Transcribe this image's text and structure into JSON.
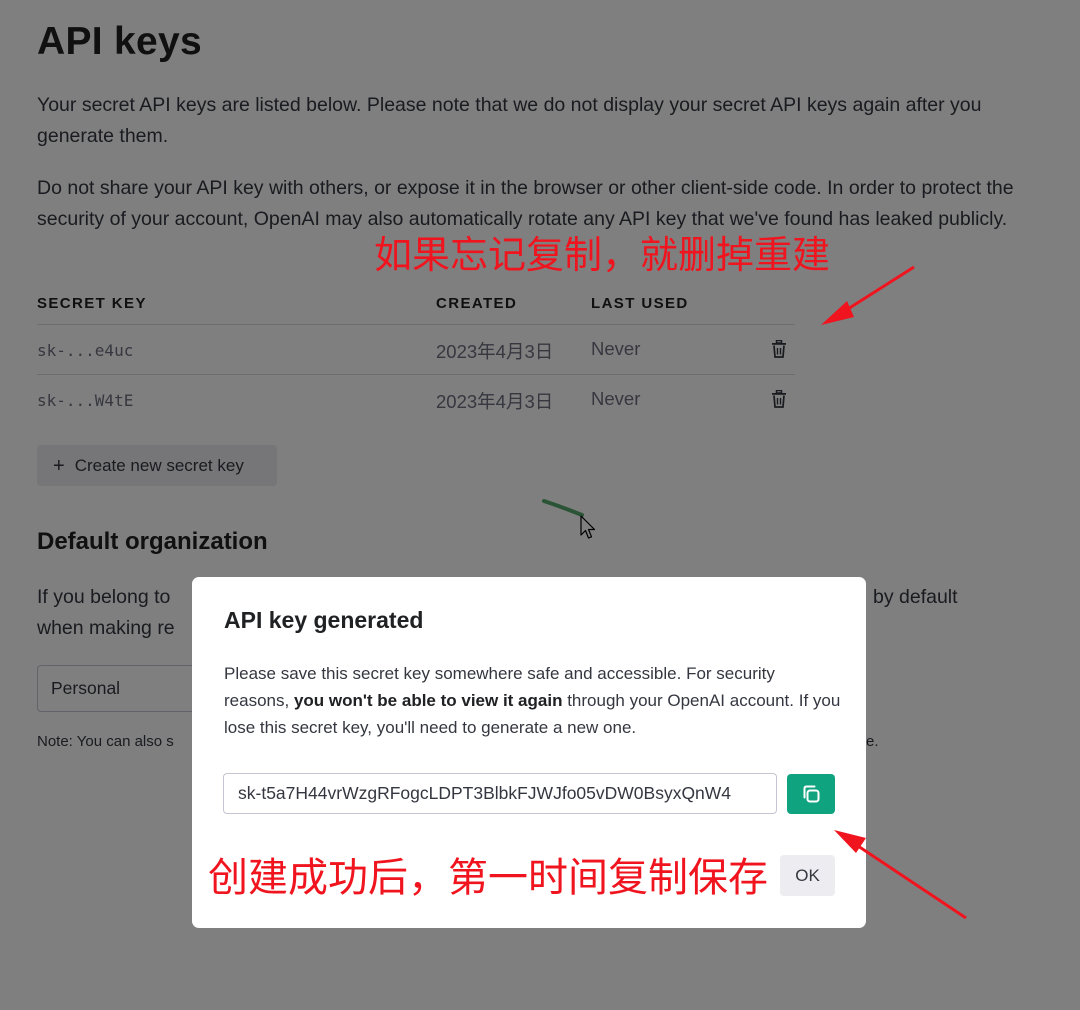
{
  "page": {
    "title": "API keys",
    "intro": "Your secret API keys are listed below. Please note that we do not display your secret API keys again after you generate them.",
    "warning": "Do not share your API key with others, or expose it in the browser or other client-side code. In order to protect the security of your account, OpenAI may also automatically rotate any API key that we've found has leaked publicly."
  },
  "table": {
    "headers": [
      "SECRET KEY",
      "CREATED",
      "LAST USED"
    ],
    "rows": [
      {
        "key": "sk-...e4uc",
        "created": "2023年4月3日",
        "last_used": "Never",
        "action_icon": "trash-icon"
      },
      {
        "key": "sk-...W4tE",
        "created": "2023年4月3日",
        "last_used": "Never",
        "action_icon": "trash-icon"
      }
    ]
  },
  "create_button": {
    "icon": "plus-icon",
    "label": "Create new secret key"
  },
  "default_org": {
    "title": "Default organization",
    "text_left": "If you belong to",
    "text_right": "by default",
    "text_line2": "when making re",
    "select_value": "Personal",
    "note_left": "Note: You can also s",
    "note_right": "e."
  },
  "modal": {
    "title": "API key generated",
    "body_1": "Please save this secret key somewhere safe and accessible. For security reasons, ",
    "body_bold": "you won't be able to view it again",
    "body_2": " through your OpenAI account. If you lose this secret key, you'll need to generate a new one.",
    "key_value": "sk-t5a7H44vrWzgRFogcLDPT3BlbkFJWJfo05vDW0BsyxQnW4",
    "copy_icon": "copy-icon",
    "ok_label": "OK"
  },
  "annotations": {
    "top": "如果忘记复制，就删掉重建",
    "bottom": "创建成功后，第一时间复制保存"
  },
  "colors": {
    "accent": "#10a37f",
    "annotation": "#f0141e",
    "overlay": "rgba(0,0,0,0.5)"
  }
}
